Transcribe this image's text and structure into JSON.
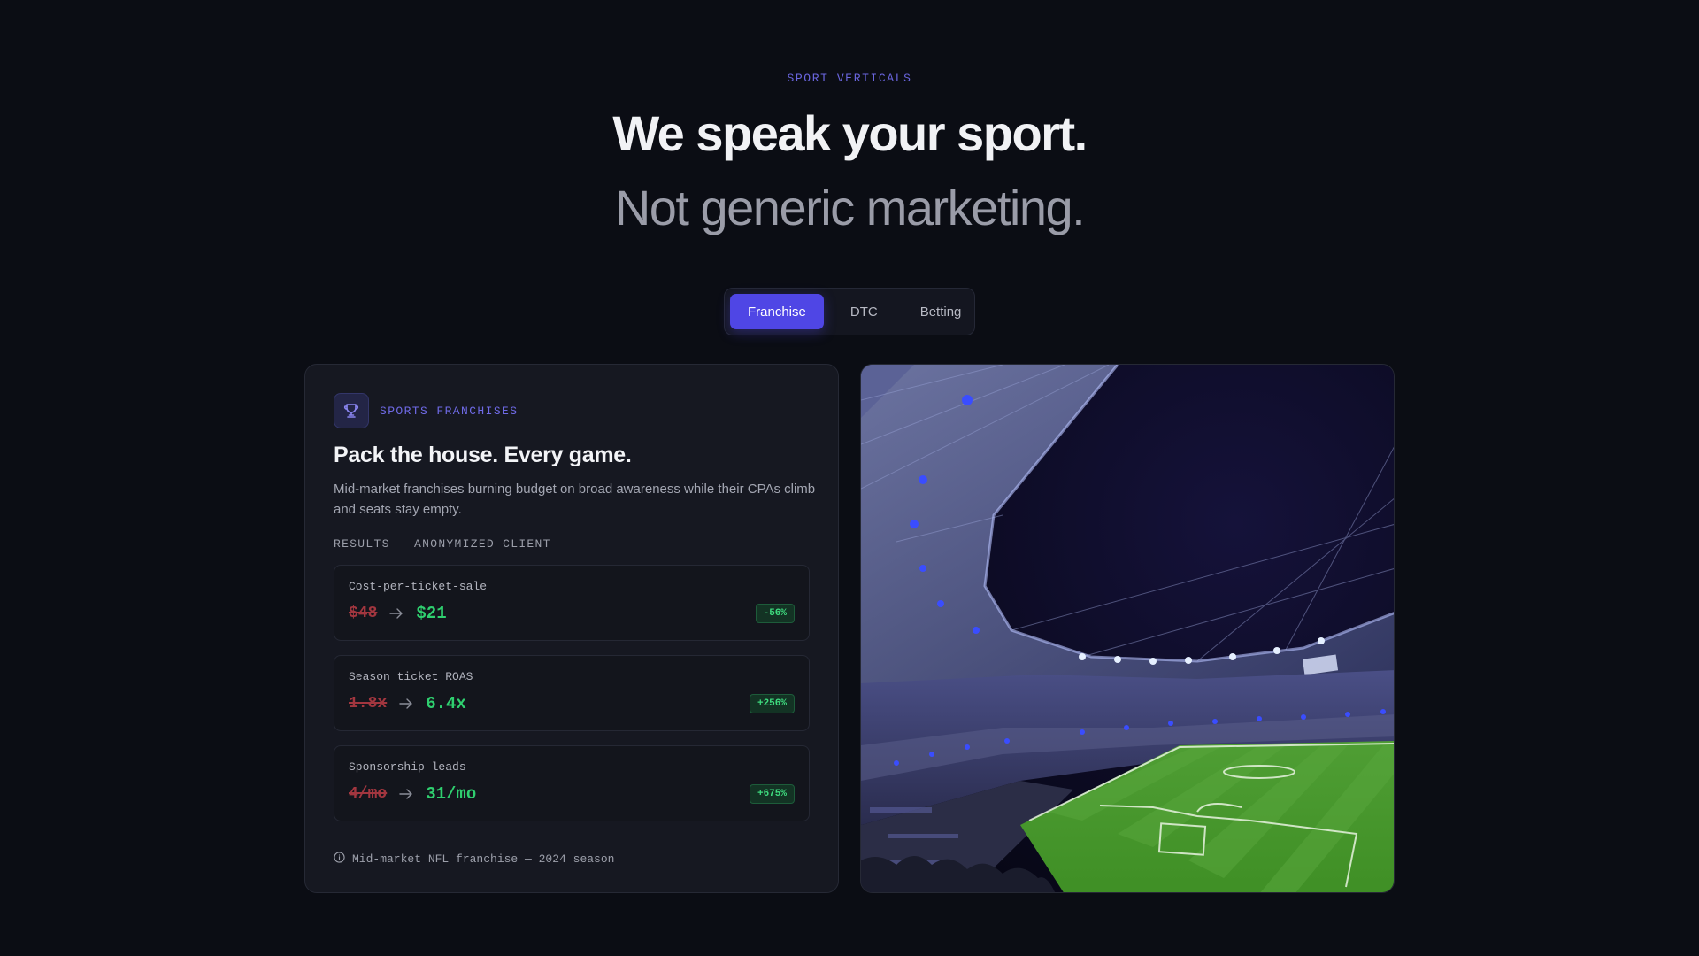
{
  "hero": {
    "eyebrow": "SPORT VERTICALS",
    "headline": "We speak your sport.",
    "subhead": "Not generic marketing."
  },
  "tabs": [
    {
      "label": "Franchise",
      "active": true
    },
    {
      "label": "DTC",
      "active": false
    },
    {
      "label": "Betting",
      "active": false
    }
  ],
  "card": {
    "icon": "trophy-icon",
    "category": "SPORTS FRANCHISES",
    "title": "Pack the house. Every game.",
    "description": "Mid-market franchises burning budget on broad awareness while their CPAs climb and seats stay empty.",
    "results_label": "RESULTS — ANONYMIZED CLIENT",
    "metrics": [
      {
        "name": "Cost-per-ticket-sale",
        "before": "$48",
        "after": "$21",
        "delta": "-56%"
      },
      {
        "name": "Season ticket ROAS",
        "before": "1.8x",
        "after": "6.4x",
        "delta": "+256%"
      },
      {
        "name": "Sponsorship leads",
        "before": "4/mo",
        "after": "31/mo",
        "delta": "+675%"
      }
    ],
    "footnote": "Mid-market NFL franchise — 2024 season",
    "footnote_icon": "info-icon"
  },
  "colors": {
    "accent": "#4f46e5",
    "background": "#0b0d14",
    "positive": "#2fcf6f",
    "negative": "#a2363f"
  }
}
